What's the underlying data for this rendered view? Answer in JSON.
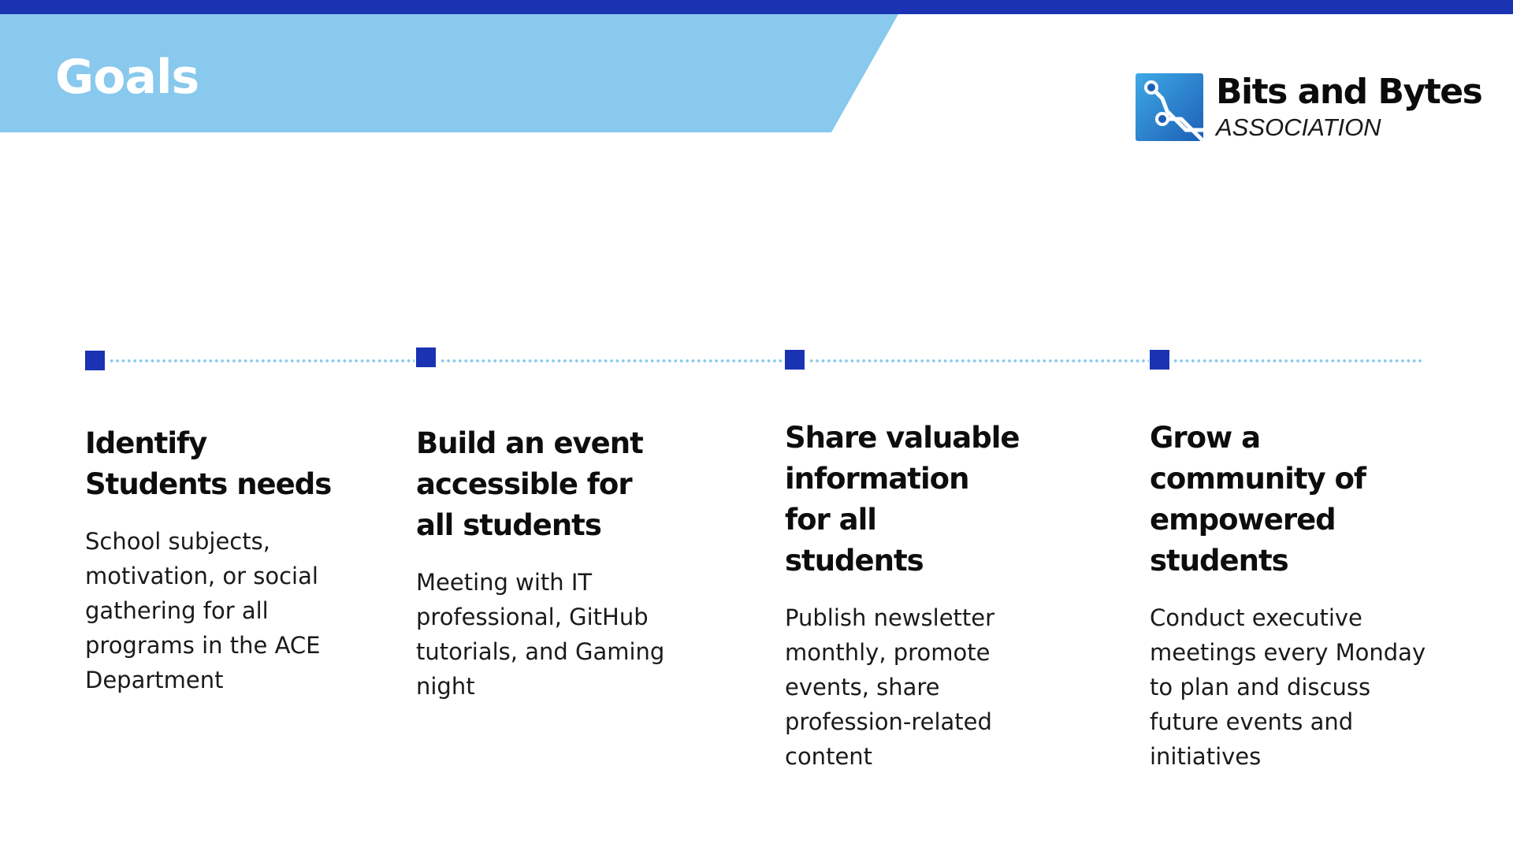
{
  "slide": {
    "title": "Goals",
    "colors": {
      "top_bar": "#1a33b3",
      "banner": "#88c9ed",
      "marker": "#1a33b3",
      "dotted_line": "#88c9ed"
    }
  },
  "logo": {
    "name": "Bits and Bytes",
    "subtitle": "ASSOCIATION",
    "icon": "circuit-board-icon"
  },
  "goals": [
    {
      "heading": "Identify Students needs",
      "body": "School subjects, motivation, or social gathering for all programs in the ACE Department"
    },
    {
      "heading": "Build an event accessible for all students",
      "body": "Meeting with IT professional, GitHub tutorials, and Gaming night"
    },
    {
      "heading": "Share valuable information for all students",
      "body": "Publish newsletter monthly, promote events, share profession-related content"
    },
    {
      "heading": "Grow a community of empowered students",
      "body": "Conduct executive meetings every Monday to plan and discuss future events and initiatives"
    }
  ]
}
